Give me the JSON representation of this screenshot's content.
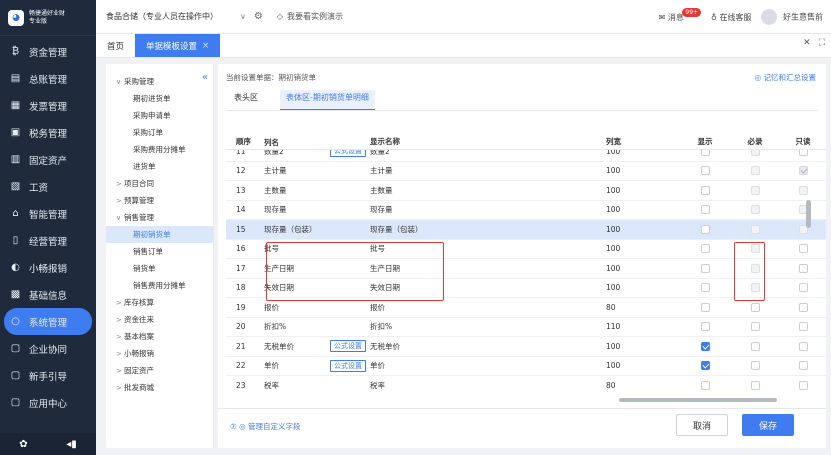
{
  "app": {
    "logo_text_1": "畅捷通好业财",
    "logo_text_2": "专业版"
  },
  "sidebar": {
    "items": [
      {
        "icon": "₿",
        "label": "资金管理",
        "icon_name": "fund-icon"
      },
      {
        "icon": "▤",
        "label": "总账管理",
        "icon_name": "ledger-icon"
      },
      {
        "icon": "▦",
        "label": "发票管理",
        "icon_name": "invoice-icon"
      },
      {
        "icon": "▣",
        "label": "税务管理",
        "icon_name": "tax-icon"
      },
      {
        "icon": "▥",
        "label": "固定资产",
        "icon_name": "asset-icon"
      },
      {
        "icon": "▧",
        "label": "工资",
        "icon_name": "salary-icon"
      },
      {
        "icon": "⌂",
        "label": "智能管理",
        "icon_name": "smart-icon"
      },
      {
        "icon": "▯",
        "label": "经营管理",
        "icon_name": "business-icon"
      },
      {
        "icon": "◐",
        "label": "小畅报销",
        "icon_name": "expense-icon"
      },
      {
        "icon": "▩",
        "label": "基础信息",
        "icon_name": "basic-icon"
      },
      {
        "icon": "○",
        "label": "系统管理",
        "icon_name": "system-icon"
      },
      {
        "icon": "▢",
        "label": "企业协同",
        "icon_name": "collab-icon"
      },
      {
        "icon": "▢",
        "label": "新手引导",
        "icon_name": "guide-icon"
      },
      {
        "icon": "▢",
        "label": "应用中心",
        "icon_name": "app-center-icon"
      }
    ],
    "active_index": 10,
    "bottom_left": "✿",
    "bottom_right": "◂▮"
  },
  "topbar": {
    "account": "食品合储（专业人员在操作中）",
    "demo": "我要看实例演示",
    "messages": "消息",
    "badge": "99+",
    "service": "在线客服",
    "user": "好生意售前"
  },
  "tabs": [
    {
      "label": "首页",
      "active": false
    },
    {
      "label": "单据模板设置",
      "active": true
    }
  ],
  "tabs_right": [
    "✕",
    "⛶"
  ],
  "tree": {
    "collapse": "«",
    "items": [
      {
        "label": "采购管理",
        "level": 0,
        "arrow": "∨"
      },
      {
        "label": "期初进货单",
        "level": 1
      },
      {
        "label": "采购申请单",
        "level": 1
      },
      {
        "label": "采购订单",
        "level": 1
      },
      {
        "label": "采购费用分摊单",
        "level": 1
      },
      {
        "label": "进货单",
        "level": 1
      },
      {
        "label": "项目合同",
        "level": 0,
        "arrow": ">"
      },
      {
        "label": "预算管理",
        "level": 0,
        "arrow": ">"
      },
      {
        "label": "销售管理",
        "level": 0,
        "arrow": "∨"
      },
      {
        "label": "期初销货单",
        "level": 1,
        "selected": true
      },
      {
        "label": "销售订单",
        "level": 1
      },
      {
        "label": "销货单",
        "level": 1
      },
      {
        "label": "销售费用分摊单",
        "level": 1
      },
      {
        "label": "库存核算",
        "level": 0,
        "arrow": ">"
      },
      {
        "label": "资金往来",
        "level": 0,
        "arrow": ">"
      },
      {
        "label": "基本档案",
        "level": 0,
        "arrow": ">"
      },
      {
        "label": "小畅报销",
        "level": 0,
        "arrow": ">"
      },
      {
        "label": "固定资产",
        "level": 0,
        "arrow": ">"
      },
      {
        "label": "批发商城",
        "level": 0,
        "arrow": ">"
      }
    ]
  },
  "main": {
    "current": "当前设置单据：期初销货单",
    "memo": "◎ 记忆和汇总设置",
    "subtabs": [
      {
        "label": "表头区",
        "active": false
      },
      {
        "label": "表体区-期初销货单明细",
        "active": true
      }
    ],
    "columns": [
      "顺序",
      "列名",
      "显示名称",
      "列宽",
      "显示",
      "必录",
      "只读"
    ],
    "formula_label": "公式设置",
    "rows": [
      {
        "seq": "11",
        "name": "数量2",
        "display": "数量2",
        "width": "100",
        "formula": true,
        "show": "u",
        "req": "d",
        "ro": "u"
      },
      {
        "seq": "12",
        "name": "主计量",
        "display": "主计量",
        "width": "100",
        "formula": false,
        "show": "u",
        "req": "d",
        "ro": "cd"
      },
      {
        "seq": "13",
        "name": "主数量",
        "display": "主数量",
        "width": "100",
        "formula": false,
        "show": "u",
        "req": "d",
        "ro": "d"
      },
      {
        "seq": "14",
        "name": "现存量",
        "display": "现存量",
        "width": "100",
        "formula": false,
        "show": "u",
        "req": "d",
        "ro": "d"
      },
      {
        "seq": "15",
        "name": "现存量（包装）",
        "display": "现存量（包装）",
        "width": "100",
        "formula": false,
        "show": "u",
        "req": "d",
        "ro": "d",
        "hl": true
      },
      {
        "seq": "16",
        "name": "批号",
        "display": "批号",
        "width": "100",
        "formula": false,
        "show": "u",
        "req": "d",
        "ro": "u"
      },
      {
        "seq": "17",
        "name": "生产日期",
        "display": "生产日期",
        "width": "100",
        "formula": false,
        "show": "u",
        "req": "d",
        "ro": "u"
      },
      {
        "seq": "18",
        "name": "失效日期",
        "display": "失效日期",
        "width": "100",
        "formula": false,
        "show": "u",
        "req": "d",
        "ro": "u"
      },
      {
        "seq": "19",
        "name": "报价",
        "display": "报价",
        "width": "80",
        "formula": false,
        "show": "u",
        "req": "u",
        "ro": "u"
      },
      {
        "seq": "20",
        "name": "折扣%",
        "display": "折扣%",
        "width": "110",
        "formula": false,
        "show": "u",
        "req": "u",
        "ro": "u"
      },
      {
        "seq": "21",
        "name": "无税单价",
        "display": "无税单价",
        "width": "100",
        "formula": true,
        "show": "c",
        "req": "u",
        "ro": "u"
      },
      {
        "seq": "22",
        "name": "单价",
        "display": "单价",
        "width": "100",
        "formula": true,
        "show": "c",
        "req": "u",
        "ro": "u"
      },
      {
        "seq": "23",
        "name": "税率",
        "display": "税率",
        "width": "80",
        "formula": false,
        "show": "u",
        "req": "u",
        "ro": "u"
      }
    ]
  },
  "footer": {
    "manage": "⑦ ◎ 管理自定义字段",
    "cancel": "取消",
    "save": "保存"
  }
}
